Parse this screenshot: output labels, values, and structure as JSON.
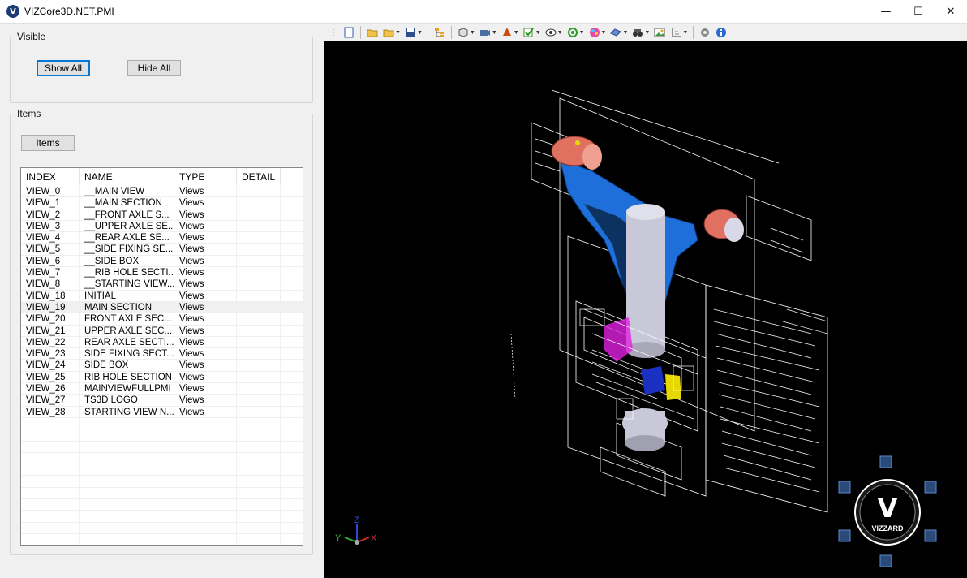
{
  "window": {
    "title": "VIZCore3D.NET.PMI",
    "app_icon_letter": "V",
    "minimize": "—",
    "maximize": "☐",
    "close": "✕"
  },
  "visible_group": {
    "label": "Visible",
    "show_all": "Show All",
    "hide_all": "Hide All"
  },
  "items_group": {
    "label": "Items",
    "items_button": "Items"
  },
  "table": {
    "columns": [
      "INDEX",
      "NAME",
      "TYPE",
      "DETAIL"
    ],
    "rows": [
      [
        "VIEW_0",
        "__MAIN VIEW",
        "Views",
        ""
      ],
      [
        "VIEW_1",
        "__MAIN SECTION",
        "Views",
        ""
      ],
      [
        "VIEW_2",
        "__FRONT AXLE S...",
        "Views",
        ""
      ],
      [
        "VIEW_3",
        "__UPPER AXLE SE...",
        "Views",
        ""
      ],
      [
        "VIEW_4",
        "__REAR AXLE SE...",
        "Views",
        ""
      ],
      [
        "VIEW_5",
        "__SIDE FIXING SE...",
        "Views",
        ""
      ],
      [
        "VIEW_6",
        "__SIDE BOX",
        "Views",
        ""
      ],
      [
        "VIEW_7",
        "__RIB HOLE SECTI...",
        "Views",
        ""
      ],
      [
        "VIEW_8",
        "__STARTING VIEW...",
        "Views",
        ""
      ],
      [
        "VIEW_18",
        "INITIAL",
        "Views",
        ""
      ],
      [
        "VIEW_19",
        "MAIN SECTION",
        "Views",
        ""
      ],
      [
        "VIEW_20",
        "FRONT AXLE SEC...",
        "Views",
        ""
      ],
      [
        "VIEW_21",
        "UPPER AXLE SEC...",
        "Views",
        ""
      ],
      [
        "VIEW_22",
        "REAR AXLE SECTI...",
        "Views",
        ""
      ],
      [
        "VIEW_23",
        "SIDE FIXING SECT...",
        "Views",
        ""
      ],
      [
        "VIEW_24",
        "SIDE BOX",
        "Views",
        ""
      ],
      [
        "VIEW_25",
        "RIB HOLE SECTION",
        "Views",
        ""
      ],
      [
        "VIEW_26",
        "MAINVIEWFULLPMI",
        "Views",
        ""
      ],
      [
        "VIEW_27",
        "TS3D LOGO",
        "Views",
        ""
      ],
      [
        "VIEW_28",
        "STARTING VIEW N...",
        "Views",
        ""
      ]
    ],
    "selected_index": 10,
    "empty_rows": 11
  },
  "toolbar": {
    "icons": [
      "new-icon",
      "open-folder-icon",
      "open-folder-dropdown-icon",
      "save-icon",
      "tree-icon",
      "box-view-icon",
      "camera-icon",
      "color-fill-icon",
      "checkbox-icon",
      "eye-icon",
      "rotate-icon",
      "palette-icon",
      "measure-icon",
      "binoculars-icon",
      "image-icon",
      "axis-icon",
      "settings-icon",
      "info-icon"
    ]
  },
  "viewport": {
    "background": "#000000",
    "triad": {
      "x": "X",
      "y": "Y",
      "z": "Z"
    },
    "logo_text": "VIZZARD",
    "logo_letter": "V",
    "colors": {
      "part_blue": "#1e6fd9",
      "part_red": "#e07060",
      "part_gray": "#c8c8d8",
      "part_magenta": "#e020e0",
      "part_yellow": "#e6d800"
    }
  }
}
